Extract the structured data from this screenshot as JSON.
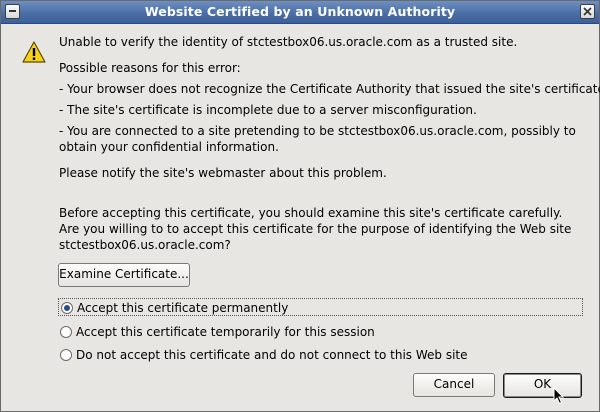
{
  "window": {
    "title": "Website Certified by an Unknown Authority"
  },
  "icons": {
    "warning": "warning-icon",
    "titlebar_left": "window-menu-icon",
    "titlebar_right": "close-icon"
  },
  "message": {
    "headline": "Unable to verify the identity of stctestbox06.us.oracle.com as a trusted site.",
    "reasons_title": "Possible reasons for this error:",
    "reasons": [
      "- Your browser does not recognize the Certificate Authority that issued the site's certificate.",
      "- The site's certificate is incomplete due to a server misconfiguration.",
      "- You are connected to a site pretending to be stctestbox06.us.oracle.com, possibly to obtain your confidential information."
    ],
    "notify": "Please notify the site's webmaster about this problem.",
    "question": "Before accepting this certificate, you should examine this site's certificate carefully. Are you willing to to accept this certificate for the purpose of identifying the Web site stctestbox06.us.oracle.com?"
  },
  "examine_button": "Examine Certificate...",
  "options": [
    {
      "label": "Accept this certificate permanently",
      "selected": true
    },
    {
      "label": "Accept this certificate temporarily for this session",
      "selected": false
    },
    {
      "label": "Do not accept this certificate and do not connect to this Web site",
      "selected": false
    }
  ],
  "buttons": {
    "cancel": "Cancel",
    "ok": "OK"
  }
}
